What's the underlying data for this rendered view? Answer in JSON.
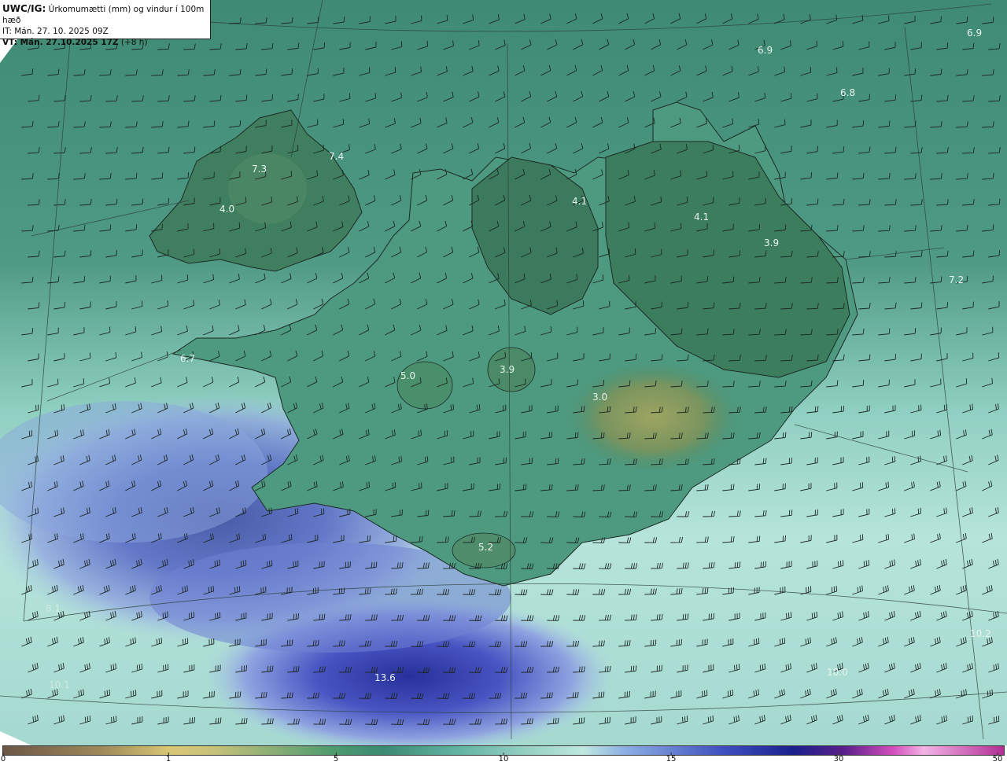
{
  "header": {
    "product": "UWC/IG:",
    "title": "Úrkomumætti (mm) og vindur í 100m hæð",
    "init_time": "IT: Mán. 27. 10. 2025 09Z",
    "valid_time_bold": "VT: Mán. 27.10.2025 17Z",
    "valid_time_offset": "(+8 h)"
  },
  "map_values": [
    {
      "id": "v69a",
      "text": "6.9"
    },
    {
      "id": "v69b",
      "text": "6.9"
    },
    {
      "id": "v68",
      "text": "6.8"
    },
    {
      "id": "v73",
      "text": "7.3"
    },
    {
      "id": "v74",
      "text": "7.4"
    },
    {
      "id": "v40",
      "text": "4.0"
    },
    {
      "id": "v41a",
      "text": "4.1"
    },
    {
      "id": "v41b",
      "text": "4.1"
    },
    {
      "id": "v39a",
      "text": "3.9"
    },
    {
      "id": "v72",
      "text": "7.2"
    },
    {
      "id": "v67",
      "text": "6.7"
    },
    {
      "id": "v50",
      "text": "5.0"
    },
    {
      "id": "v39b",
      "text": "3.9"
    },
    {
      "id": "v30",
      "text": "3.0"
    },
    {
      "id": "v52",
      "text": "5.2"
    },
    {
      "id": "v81",
      "text": "8.1"
    },
    {
      "id": "v102",
      "text": "10.2"
    },
    {
      "id": "v100",
      "text": "10.0"
    },
    {
      "id": "v136",
      "text": "13.6"
    },
    {
      "id": "v101",
      "text": "10.1"
    }
  ],
  "colorbar": {
    "ticks": [
      "0",
      "1",
      "5",
      "10",
      "15",
      "30",
      "50"
    ]
  },
  "colors": {
    "land_dark": "#3f7f5f",
    "sea_mid": "#4e9a86",
    "sea_light": "#a9ddd2",
    "precip_blue": "#5a6bd0",
    "precip_deep": "#27309a",
    "plateau": "#8f9e58"
  }
}
